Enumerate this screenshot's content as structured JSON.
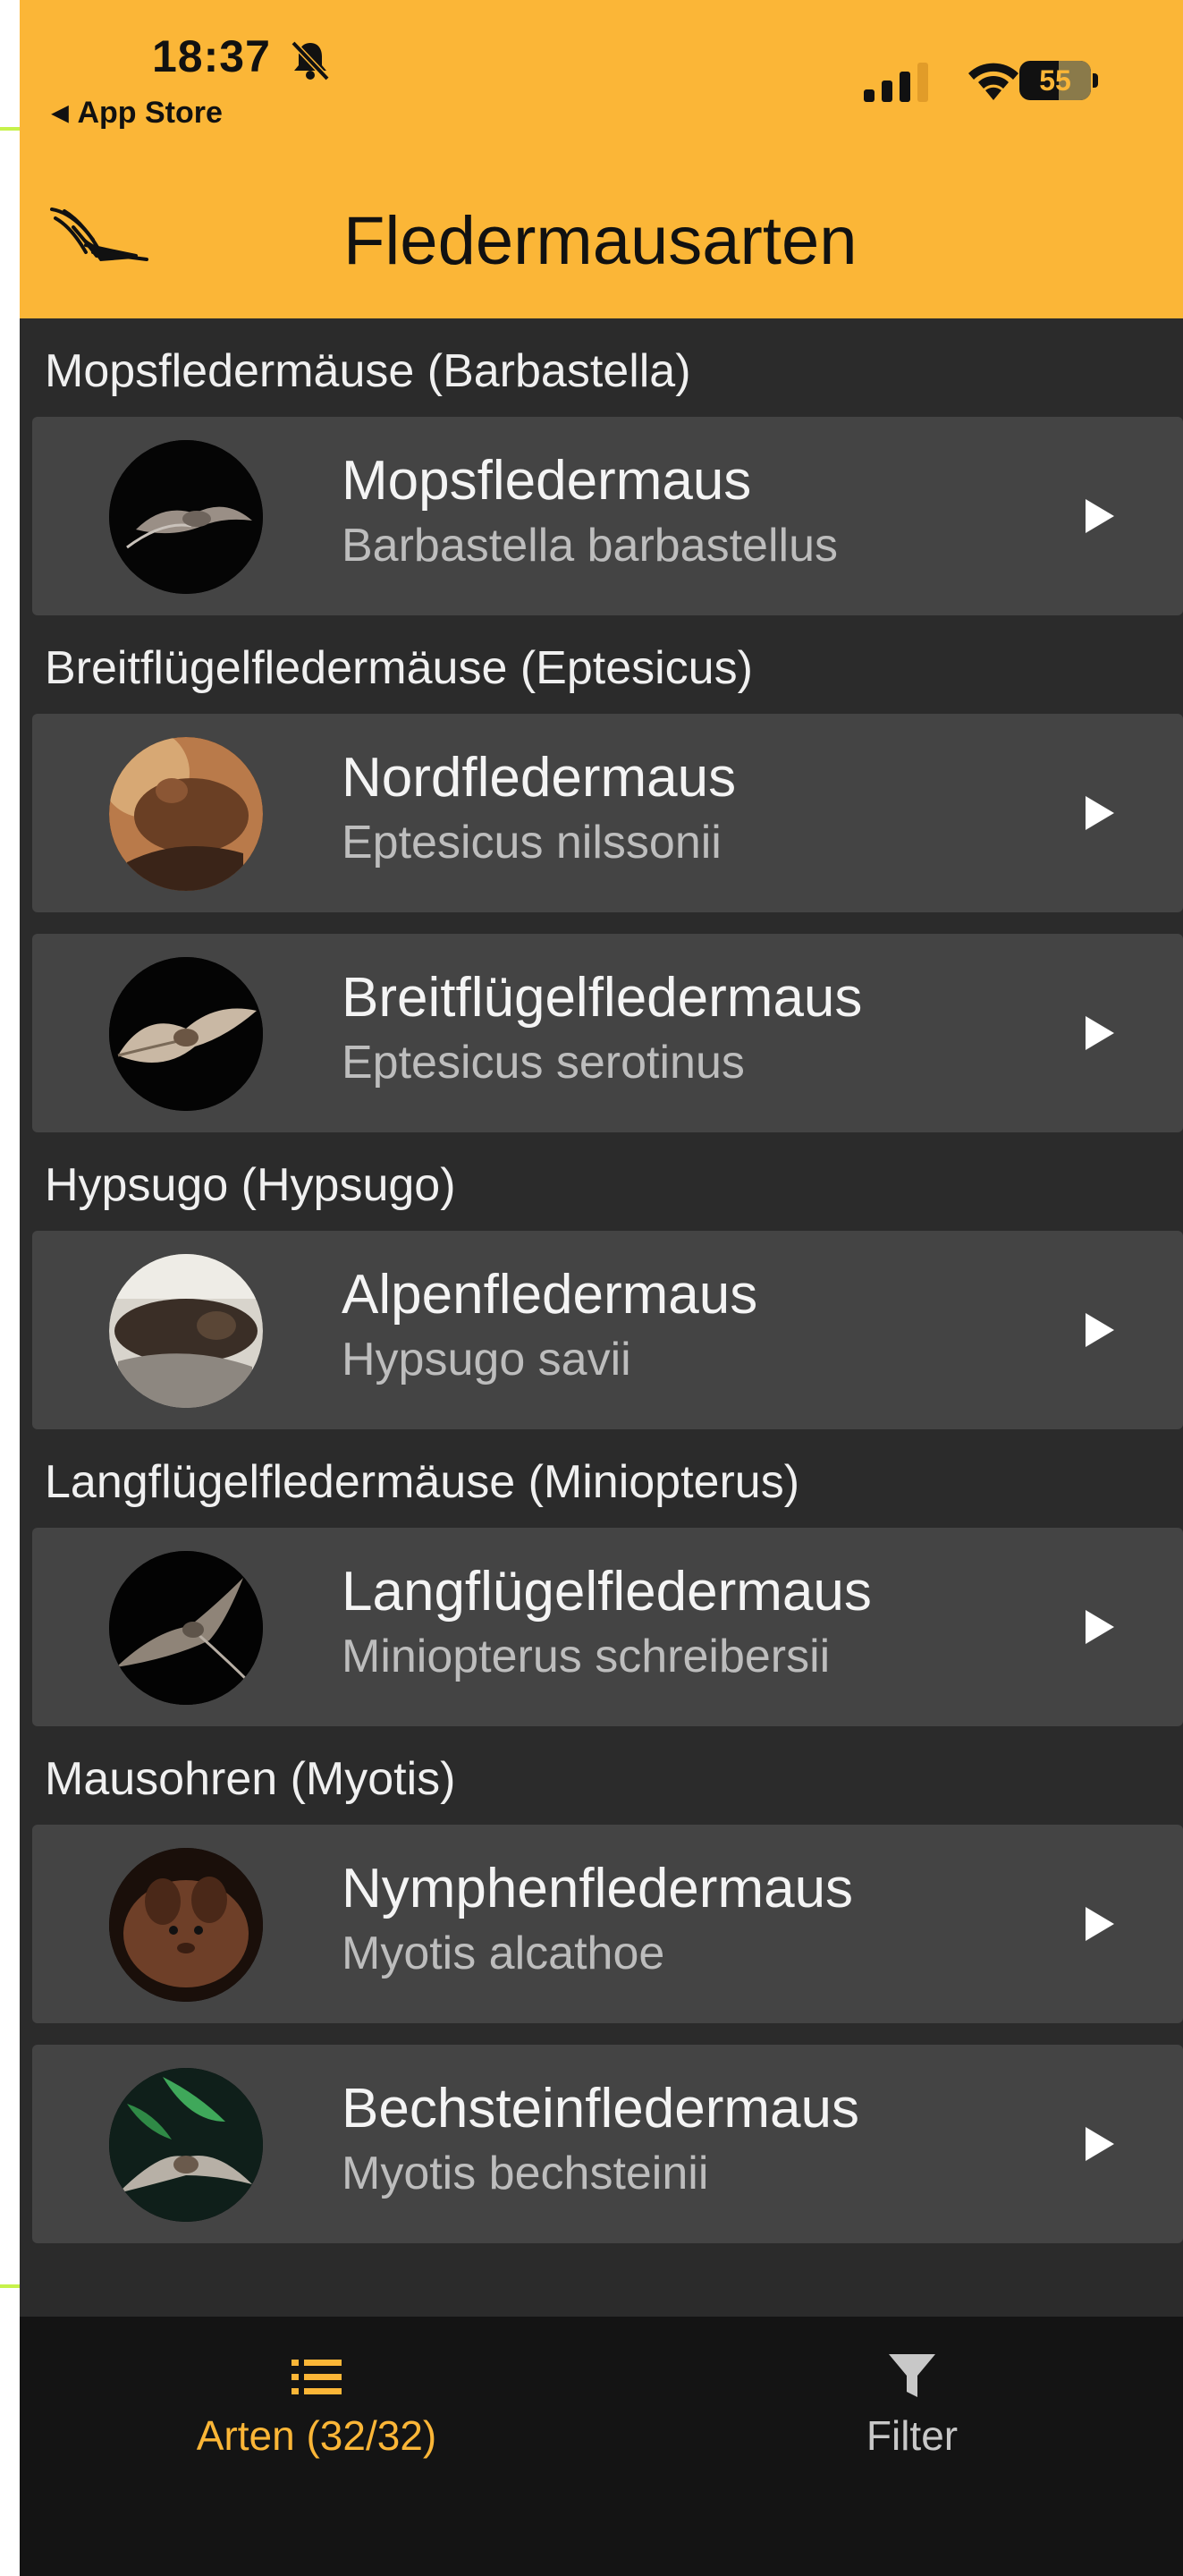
{
  "status_bar": {
    "time": "18:37",
    "back_app": "App Store",
    "battery": "55"
  },
  "header": {
    "title": "Fledermausarten"
  },
  "colors": {
    "accent": "#fbb637",
    "background": "#2b2b2b",
    "card": "#444444",
    "tabbar": "#141414"
  },
  "sections": [
    {
      "title": "Mopsfledermäuse (Barbastella)",
      "items": [
        {
          "name": "Mopsfledermaus",
          "scientific": "Barbastella barbastellus"
        }
      ]
    },
    {
      "title": "Breitflügelfledermäuse (Eptesicus)",
      "items": [
        {
          "name": "Nordfledermaus",
          "scientific": "Eptesicus nilssonii"
        },
        {
          "name": "Breitflügelfledermaus",
          "scientific": "Eptesicus serotinus"
        }
      ]
    },
    {
      "title": "Hypsugo (Hypsugo)",
      "items": [
        {
          "name": "Alpenfledermaus",
          "scientific": "Hypsugo savii"
        }
      ]
    },
    {
      "title": "Langflügelfledermäuse (Miniopterus)",
      "items": [
        {
          "name": "Langflügelfledermaus",
          "scientific": "Miniopterus schreibersii"
        }
      ]
    },
    {
      "title": "Mausohren (Myotis)",
      "items": [
        {
          "name": "Nymphenfledermaus",
          "scientific": "Myotis alcathoe"
        },
        {
          "name": "Bechsteinfledermaus",
          "scientific": "Myotis bechsteinii"
        }
      ]
    }
  ],
  "tabs": {
    "arten": {
      "label": "Arten (32/32)",
      "icon": "list-icon",
      "active": true
    },
    "filter": {
      "label": "Filter",
      "icon": "filter-icon",
      "active": false
    }
  }
}
